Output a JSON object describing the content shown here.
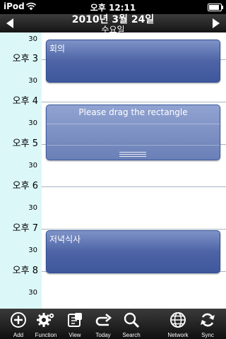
{
  "status_bar": {
    "carrier": "iPod",
    "time": "오후 12:11",
    "battery_level": 0.85
  },
  "header": {
    "date": "2010년 3월 24일",
    "weekday": "수요일"
  },
  "timeline": {
    "hour_labels": [
      "오후 3",
      "오후 4",
      "오후 5",
      "오후 6",
      "오후 7",
      "오후 8"
    ],
    "minute_label": "30"
  },
  "events": [
    {
      "title": "회의",
      "selected": false
    },
    {
      "title": "Please drag the rectangle",
      "selected": true
    },
    {
      "title": "저녁식사",
      "selected": false
    }
  ],
  "toolbar": {
    "add": "Add",
    "function": "Function",
    "view": "View",
    "today": "Today",
    "search": "Search",
    "network": "Network",
    "sync": "Sync"
  }
}
